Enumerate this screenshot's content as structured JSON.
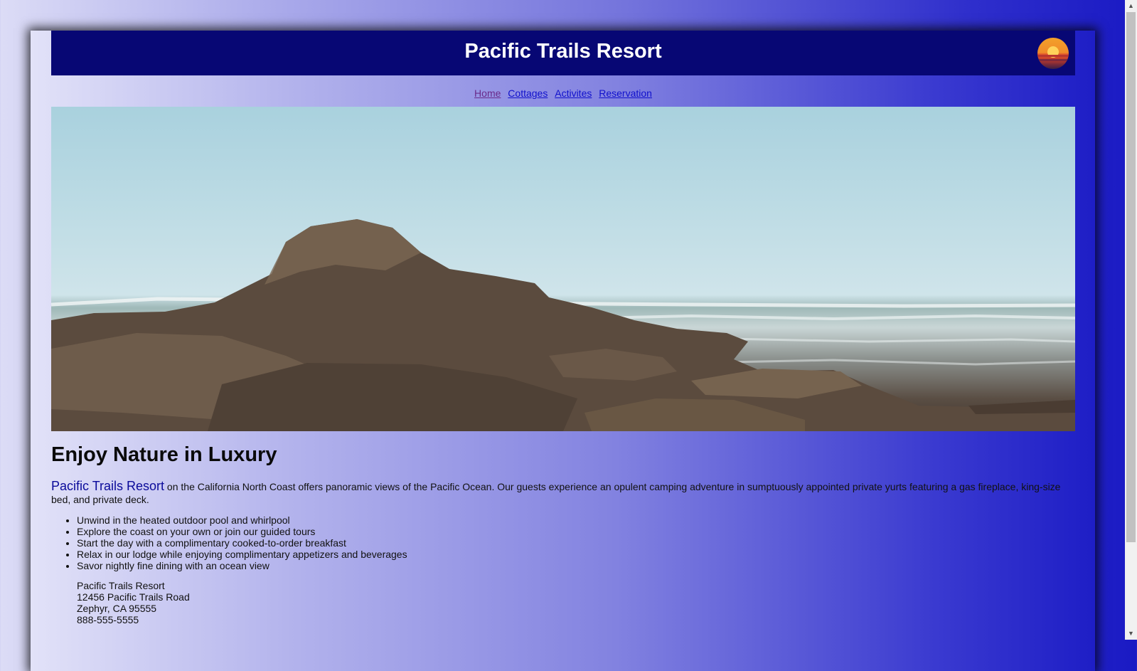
{
  "header": {
    "title": "Pacific Trails Resort"
  },
  "nav": {
    "items": [
      "Home",
      "Cottages",
      "Activites",
      "Reservation"
    ]
  },
  "main": {
    "heading": "Enjoy Nature in Luxury",
    "intro_resort": "Pacific Trails Resort",
    "intro_text": " on the California North Coast offers panoramic views of the Pacific Ocean. Our guests experience an opulent camping adventure in sumptuously appointed private yurts featuring a gas fireplace, king-size bed, and private deck.",
    "features": [
      "Unwind in the heated outdoor pool and whirlpool",
      "Explore the coast on your own or join our guided tours",
      "Start the day with a complimentary cooked-to-order breakfast",
      "Relax in our lodge while enjoying complimentary appetizers and beverages",
      "Savor nightly fine dining with an ocean view"
    ],
    "address": {
      "name": "Pacific Trails Resort",
      "street": "12456 Pacific Trails Road",
      "city": "Zephyr, CA 95555",
      "phone": "888-555-5555"
    }
  },
  "colors": {
    "header_bg": "#070774",
    "link": "#1010cc",
    "visited_link": "#6a2a8a",
    "resort_name": "#0a0a9a"
  },
  "icons": {
    "logo": "sunset-logo-icon",
    "scroll_up": "scroll-up-arrow-icon",
    "scroll_down": "scroll-down-arrow-icon"
  }
}
